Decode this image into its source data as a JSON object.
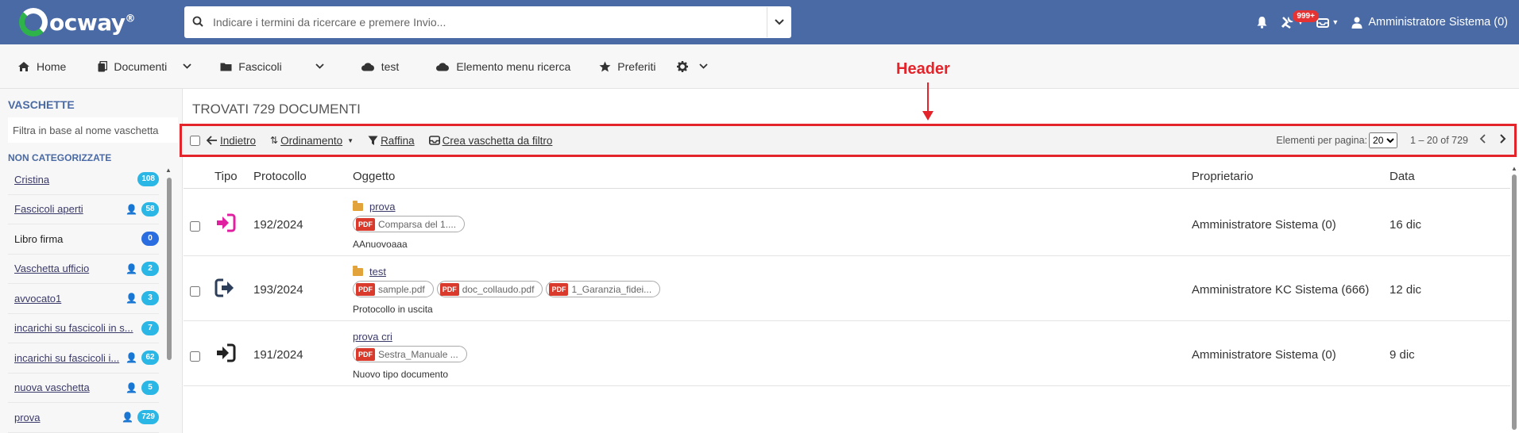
{
  "app": {
    "logo_text": "ocway",
    "logo_reg": "®",
    "search_placeholder": "Indicare i termini da ricercare e premere Invio...",
    "notifications_badge": "999+",
    "user_label": "Amministratore Sistema (0)"
  },
  "nav": {
    "home": "Home",
    "documenti": "Documenti",
    "fascicoli": "Fascicoli",
    "test": "test",
    "elemento": "Elemento menu ricerca",
    "preferiti": "Preferiti"
  },
  "sidebar": {
    "title": "VASCHETTE",
    "filter_placeholder": "Filtra in base al nome vaschetta",
    "section": "NON CATEGORIZZATE",
    "items": [
      {
        "label": "Cristina",
        "count": "108"
      },
      {
        "label": "Fascicoli aperti",
        "count": "58"
      },
      {
        "label": "Libro firma",
        "count": "0"
      },
      {
        "label": "Vaschetta ufficio",
        "count": "2"
      },
      {
        "label": "avvocato1",
        "count": "3"
      },
      {
        "label": "incarichi su fascicoli in s...",
        "count": "7"
      },
      {
        "label": "incarichi su fascicoli i...",
        "count": "62"
      },
      {
        "label": "nuova vaschetta",
        "count": "5"
      },
      {
        "label": "prova",
        "count": "729"
      }
    ]
  },
  "main": {
    "found_title": "TROVATI 729 DOCUMENTI",
    "toolbar": {
      "back": "Indietro",
      "sort": "Ordinamento",
      "refine": "Raffina",
      "create": "Crea vaschetta da filtro",
      "per_page_label": "Elementi per pagina:",
      "per_page_value": "20",
      "range": "1 – 20 of 729"
    },
    "annotation": "Header",
    "columns": {
      "tipo": "Tipo",
      "protocollo": "Protocollo",
      "oggetto": "Oggetto",
      "proprietario": "Proprietario",
      "data": "Data"
    },
    "rows": [
      {
        "protocollo": "192/2024",
        "folder": "prova",
        "files": [
          "Comparsa del 1...."
        ],
        "desc": "AAnuovoaaa",
        "owner": "Amministratore Sistema (0)",
        "date": "16 dic",
        "type_color": "#e020a0"
      },
      {
        "protocollo": "193/2024",
        "folder": "test",
        "files": [
          "sample.pdf",
          "doc_collaudo.pdf",
          "1_Garanzia_fidei..."
        ],
        "desc": "Protocollo in uscita",
        "owner": "Amministratore KC Sistema (666)",
        "date": "12 dic",
        "type_color": "#2c3e5a"
      },
      {
        "protocollo": "191/2024",
        "title_link": "prova cri",
        "files": [
          "Sestra_Manuale ..."
        ],
        "desc": "Nuovo tipo documento",
        "owner": "Amministratore Sistema (0)",
        "date": "9 dic",
        "type_color": "#222222"
      }
    ]
  }
}
